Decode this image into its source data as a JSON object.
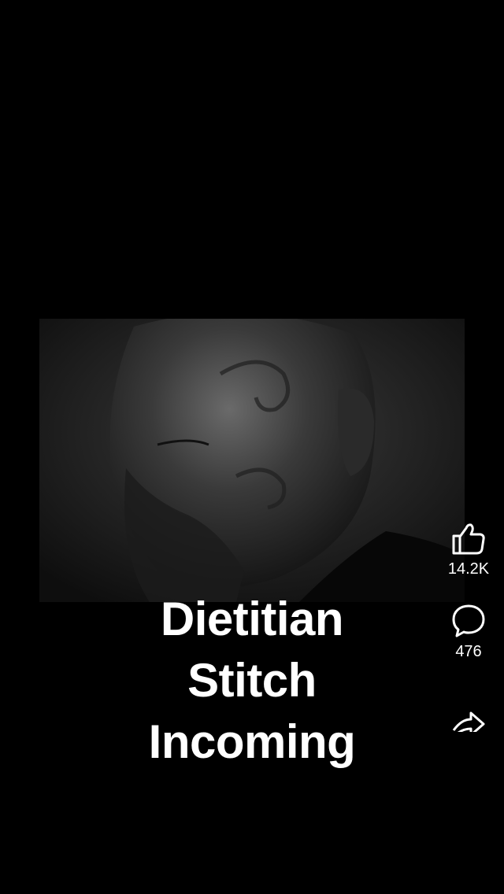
{
  "caption": {
    "lines": [
      "Dietitian",
      "Stitch",
      "Incoming"
    ]
  },
  "actions": {
    "like": {
      "icon": "thumbs-up-icon",
      "count": "14.2K"
    },
    "comment": {
      "icon": "comment-bubble-icon",
      "count": "476"
    },
    "share": {
      "icon": "share-arrow-icon"
    }
  },
  "colors": {
    "background": "#000000",
    "text": "#ffffff"
  }
}
